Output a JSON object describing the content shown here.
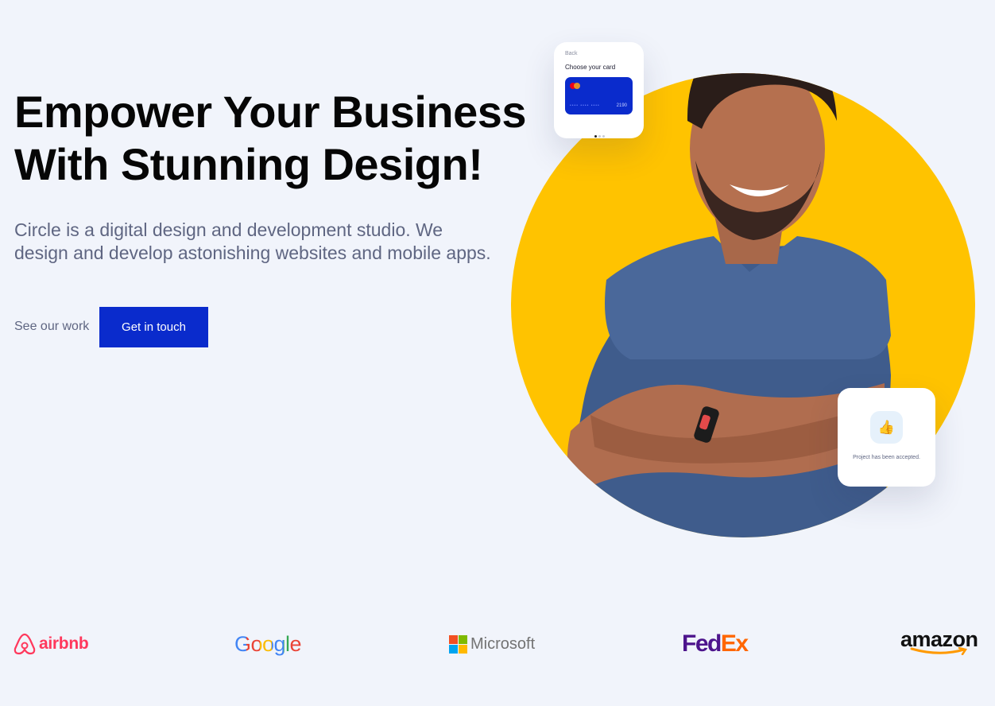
{
  "hero": {
    "title_line1": "Empower Your Business",
    "title_line2": "With Stunning Design!",
    "description": "Circle is a digital design and development studio. We design and develop astonishing websites and mobile apps.",
    "secondary_link": "See our work",
    "primary_button": "Get in touch"
  },
  "payment_card": {
    "back_label": "Back",
    "heading": "Choose your card",
    "card_masked": "•••• •••• ••••",
    "card_last4": "2190"
  },
  "accept_card": {
    "icon": "thumbs-up-icon",
    "message": "Project has been accepted."
  },
  "logos": {
    "airbnb": "airbnb",
    "google": "Google",
    "microsoft": "Microsoft",
    "fedex_a": "Fed",
    "fedex_b": "Ex",
    "amazon": "amazon"
  },
  "colors": {
    "background": "#f1f4fb",
    "accent_blue": "#0a2bcc",
    "circle_yellow": "#ffc300",
    "title_text": "#060606",
    "body_text": "#5f6682"
  }
}
